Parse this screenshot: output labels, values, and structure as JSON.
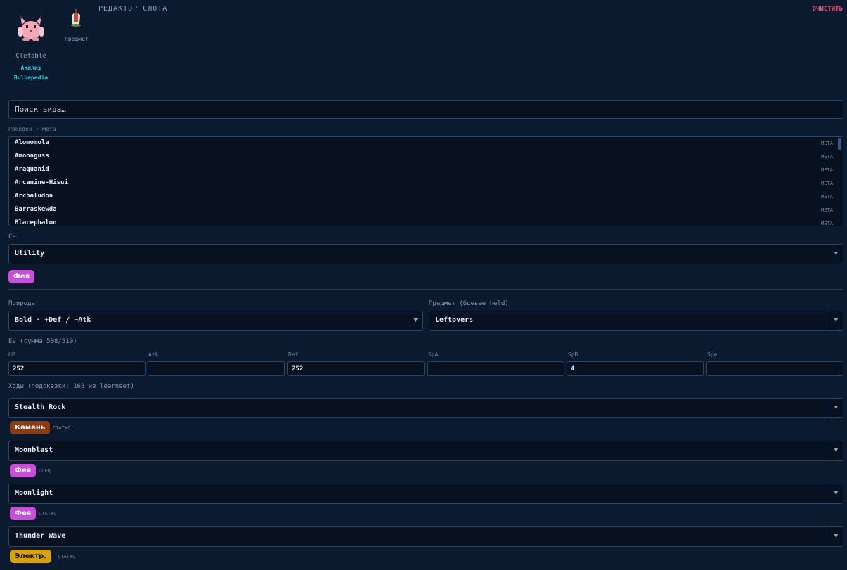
{
  "header": {
    "item_label": "предмет",
    "species": "Clefable",
    "link_analysis": "Анализ",
    "link_bulbapedia": "Bulbapedia",
    "title": "РЕДАКТОР СЛОТА",
    "clear": "ОЧИСТИТЬ"
  },
  "search": {
    "placeholder": "Поиск вида…"
  },
  "list": {
    "label": "Pokédex + мета",
    "items": [
      {
        "name": "Alomomola",
        "tag": "META"
      },
      {
        "name": "Amoonguss",
        "tag": "META"
      },
      {
        "name": "Araquanid",
        "tag": "META"
      },
      {
        "name": "Arcanine-Hisui",
        "tag": "META"
      },
      {
        "name": "Archaludon",
        "tag": "META"
      },
      {
        "name": "Barraskewda",
        "tag": "META"
      },
      {
        "name": "Blacephalon",
        "tag": "META"
      }
    ]
  },
  "set": {
    "label": "Сет",
    "value": "Utility",
    "type_badge": "Фея"
  },
  "nature": {
    "label": "Природа",
    "value": "Bold · +Def / −Atk"
  },
  "item": {
    "label": "Предмет (боевые held)",
    "value": "Leftovers"
  },
  "ev": {
    "label": "EV (сумма 508/510)",
    "stats": [
      {
        "name": "HP",
        "value": "252"
      },
      {
        "name": "Atk",
        "value": ""
      },
      {
        "name": "Def",
        "value": "252"
      },
      {
        "name": "SpA",
        "value": ""
      },
      {
        "name": "SpD",
        "value": "4"
      },
      {
        "name": "Spe",
        "value": ""
      }
    ]
  },
  "moves": {
    "label": "Ходы (подсказки: 163 из learnset)",
    "items": [
      {
        "name": "Stealth Rock",
        "type": "Камень",
        "category": "СТАТУС"
      },
      {
        "name": "Moonblast",
        "type": "Фея",
        "category": "СПЕЦ."
      },
      {
        "name": "Moonlight",
        "type": "Фея",
        "category": "СТАТУС"
      },
      {
        "name": "Thunder Wave",
        "type": "Электр.",
        "category": "СТАТУС"
      }
    ]
  },
  "colors": {
    "fairy": "#c84fd8",
    "rock": "#8a3d12",
    "electric": "#d4a312",
    "danger": "#ff4f6b",
    "link": "#39d0e0"
  }
}
